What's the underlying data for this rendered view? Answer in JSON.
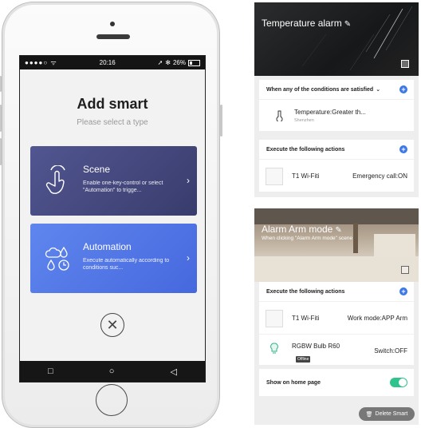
{
  "phone": {
    "status": {
      "signal": "●●●●○",
      "time": "20:16",
      "battery": "26%",
      "battery_level": 0.26
    },
    "title": "Add smart",
    "subtitle": "Please select a type",
    "scene": {
      "name": "Scene",
      "desc": "Enable one-key-control or select \"Automation\" to trigge...",
      "icon": "touch-hand-icon"
    },
    "automation": {
      "name": "Automation",
      "desc": "Execute automatically according to conditions suc...",
      "icon": "weather-clock-icon"
    },
    "close_symbol": "✕",
    "nav": {
      "back": "◁",
      "home": "○",
      "recent": "□"
    },
    "colors": {
      "scene": "#4a4e85",
      "automation": "#5479e6"
    }
  },
  "alarm_panel": {
    "title": "Temperature alarm",
    "conditions_header": "When any of the conditions are satisfied",
    "condition": {
      "name": "Temperature:Greater th...",
      "location": "Shenzhen",
      "icon": "thermometer-icon"
    },
    "actions_header": "Execute the following actions",
    "action": {
      "device": "T1 Wi-Fiti",
      "value": "Emergency call:ON"
    }
  },
  "arm_panel": {
    "title": "Alarm Arm mode",
    "subtitle": "When clicking \"Alarm Arm mode\" scene",
    "actions_header": "Execute the following actions",
    "actions": [
      {
        "device": "T1 Wi-Fiti",
        "value": "Work mode:APP Arm"
      },
      {
        "device": "RGBW Bulb R60",
        "badge": "Offline",
        "value": "Switch:OFF"
      }
    ],
    "show_home_label": "Show on home page",
    "show_home_on": true,
    "delete_label": "Delete Smart",
    "accent": "#3c78e6",
    "toggle_color": "#2fc48d"
  }
}
